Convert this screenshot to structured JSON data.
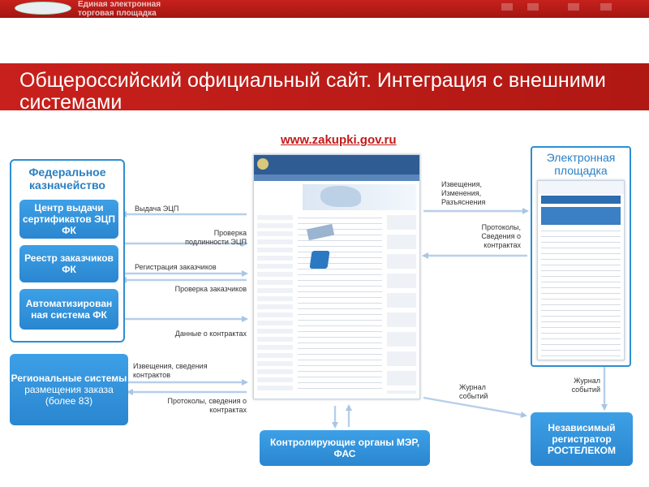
{
  "header": {
    "logo_text_line1": "Единая электронная",
    "logo_text_line2": "торговая площадка"
  },
  "title": "Общероссийский официальный сайт. Интеграция с внешними системами",
  "site_url": "www.zakupki.gov.ru",
  "federal_treasury": {
    "title": "Федеральное казначейство",
    "items": [
      "Центр выдачи сертификатов ЭЦП ФК",
      "Реестр заказчиков ФК",
      "Автоматизирован ная система ФК"
    ]
  },
  "regional": {
    "title_bold": "Региональные системы",
    "title_rest": "размещения заказа (более 83)"
  },
  "electronic_platform": {
    "title": "Электронная площадка"
  },
  "control": "Контролирующие органы МЭР, ФАС",
  "registrar": "Независимый регистратор РОСТЕЛЕКОМ",
  "labels": {
    "ecp_issue": "Выдача ЭЦП",
    "ecp_check": "Проверка подлинности ЭЦП",
    "customer_reg": "Регистрация заказчиков",
    "customer_check": "Проверка заказчиков",
    "contract_data": "Данные о контрактах",
    "notices_regional": "Извещения, сведения контрактов",
    "protocols_regional": "Протоколы, сведения о контрактах",
    "notices_platform": "Извещения, Изменения, Разъяснения",
    "protocols_platform": "Протоколы, Сведения о контрактах",
    "journal_left": "Журнал событий",
    "journal_right": "Журнал событий"
  },
  "colors": {
    "red": "#c41a18",
    "blue": "#2a86d0",
    "arrow": "#a9c6e6"
  }
}
